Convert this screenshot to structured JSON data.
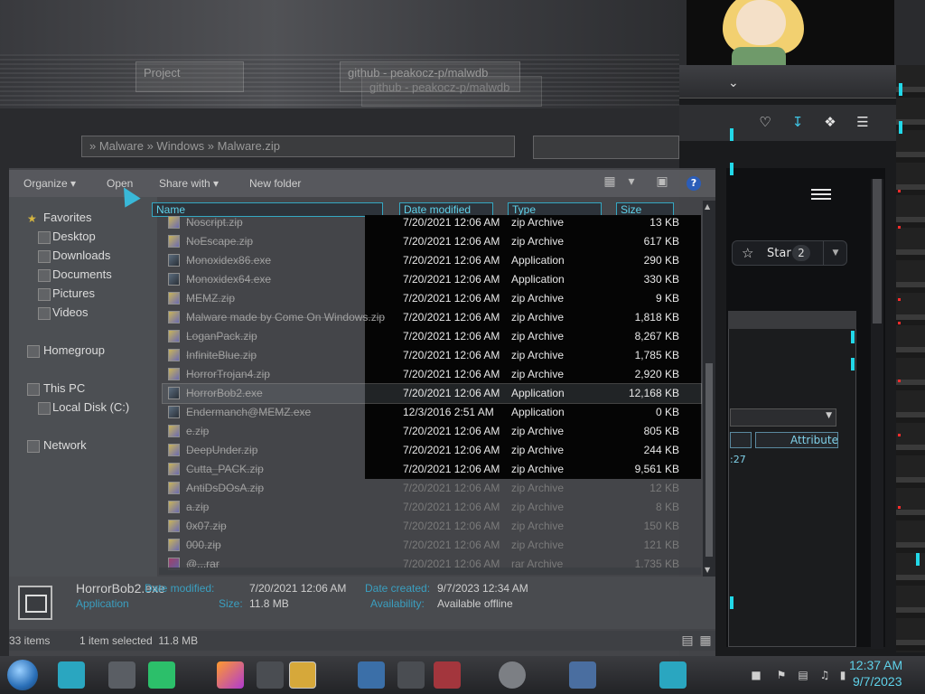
{
  "background": {
    "tabs": [
      "Project",
      "github - peakocz-p/malwdb",
      "github - peakocz-p/malwdb"
    ],
    "search_text": "» Malware » Windows » Malware.zip"
  },
  "explorer": {
    "toolbar": {
      "organize": "Organize",
      "open": "Open",
      "share_with": "Share with",
      "new_folder": "New folder",
      "help": "?"
    },
    "nav": {
      "favorites": "Favorites",
      "desktop": "Desktop",
      "downloads": "Downloads",
      "documents": "Documents",
      "pictures": "Pictures",
      "videos": "Videos",
      "homegroup": "Homegroup",
      "this_pc": "This PC",
      "local_disk": "Local Disk (C:)",
      "network": "Network"
    },
    "columns": {
      "name": "Name",
      "date_modified": "Date modified",
      "type": "Type",
      "size": "Size"
    },
    "files": [
      {
        "name": "Noscript.zip",
        "date": "7/20/2021 12:06 AM",
        "type": "zip Archive",
        "size": "13 KB",
        "icon": "zip"
      },
      {
        "name": "NoEscape.zip",
        "date": "7/20/2021 12:06 AM",
        "type": "zip Archive",
        "size": "617 KB",
        "icon": "zip"
      },
      {
        "name": "Monoxidex86.exe",
        "date": "7/20/2021 12:06 AM",
        "type": "Application",
        "size": "290 KB",
        "icon": "app"
      },
      {
        "name": "Monoxidex64.exe",
        "date": "7/20/2021 12:06 AM",
        "type": "Application",
        "size": "330 KB",
        "icon": "app"
      },
      {
        "name": "MEMZ.zip",
        "date": "7/20/2021 12:06 AM",
        "type": "zip Archive",
        "size": "9 KB",
        "icon": "zip"
      },
      {
        "name": "Malware made by Come On Windows.zip",
        "date": "7/20/2021 12:06 AM",
        "type": "zip Archive",
        "size": "1,818 KB",
        "icon": "zip"
      },
      {
        "name": "LoganPack.zip",
        "date": "7/20/2021 12:06 AM",
        "type": "zip Archive",
        "size": "8,267 KB",
        "icon": "zip"
      },
      {
        "name": "InfiniteBlue.zip",
        "date": "7/20/2021 12:06 AM",
        "type": "zip Archive",
        "size": "1,785 KB",
        "icon": "zip"
      },
      {
        "name": "HorrorTrojan4.zip",
        "date": "7/20/2021 12:06 AM",
        "type": "zip Archive",
        "size": "2,920 KB",
        "icon": "zip"
      },
      {
        "name": "HorrorBob2.exe",
        "date": "7/20/2021 12:06 AM",
        "type": "Application",
        "size": "12,168 KB",
        "icon": "app",
        "selected": true
      },
      {
        "name": "Endermanch@MEMZ.exe",
        "date": "12/3/2016 2:51 AM",
        "type": "Application",
        "size": "0 KB",
        "icon": "app"
      },
      {
        "name": "e.zip",
        "date": "7/20/2021 12:06 AM",
        "type": "zip Archive",
        "size": "805 KB",
        "icon": "zip"
      },
      {
        "name": "DeepUnder.zip",
        "date": "7/20/2021 12:06 AM",
        "type": "zip Archive",
        "size": "244 KB",
        "icon": "zip"
      },
      {
        "name": "Cutta_PACK.zip",
        "date": "7/20/2021 12:06 AM",
        "type": "zip Archive",
        "size": "9,561 KB",
        "icon": "zip"
      },
      {
        "name": "AntiDsDOsA.zip",
        "date": "7/20/2021 12:06 AM",
        "type": "zip Archive",
        "size": "12 KB",
        "icon": "zip"
      },
      {
        "name": "a.zip",
        "date": "7/20/2021 12:06 AM",
        "type": "zip Archive",
        "size": "8 KB",
        "icon": "zip"
      },
      {
        "name": "0x07.zip",
        "date": "7/20/2021 12:06 AM",
        "type": "zip Archive",
        "size": "150 KB",
        "icon": "zip"
      },
      {
        "name": "000.zip",
        "date": "7/20/2021 12:06 AM",
        "type": "zip Archive",
        "size": "121 KB",
        "icon": "zip"
      },
      {
        "name": "@...rar",
        "date": "7/20/2021 12:06 AM",
        "type": "rar Archive",
        "size": "1,735 KB",
        "icon": "rar"
      }
    ],
    "details": {
      "title": "HorrorBob2.exe",
      "subtitle": "Application",
      "date_modified_label": "Date modified:",
      "date_modified": "7/20/2021 12:06 AM",
      "size_label": "Size:",
      "size": "11.8 MB",
      "date_created_label": "Date created:",
      "date_created": "9/7/2023 12:34 AM",
      "availability_label": "Availability:",
      "availability": "Available offline"
    },
    "status": {
      "items": "33 items",
      "selected": "1 item selected  11.8 MB"
    }
  },
  "browser": {
    "star_label": "Star",
    "star_count": "2",
    "attributes_header": "Attributes",
    "attr_value": ":27"
  },
  "taskbar": {
    "time": "12:37 AM",
    "date": "9/7/2023"
  },
  "colors": {
    "accent_cyan": "#5fd2ea",
    "frame_red": "#ff2c2c",
    "frame_cyan": "#22d8e8"
  }
}
